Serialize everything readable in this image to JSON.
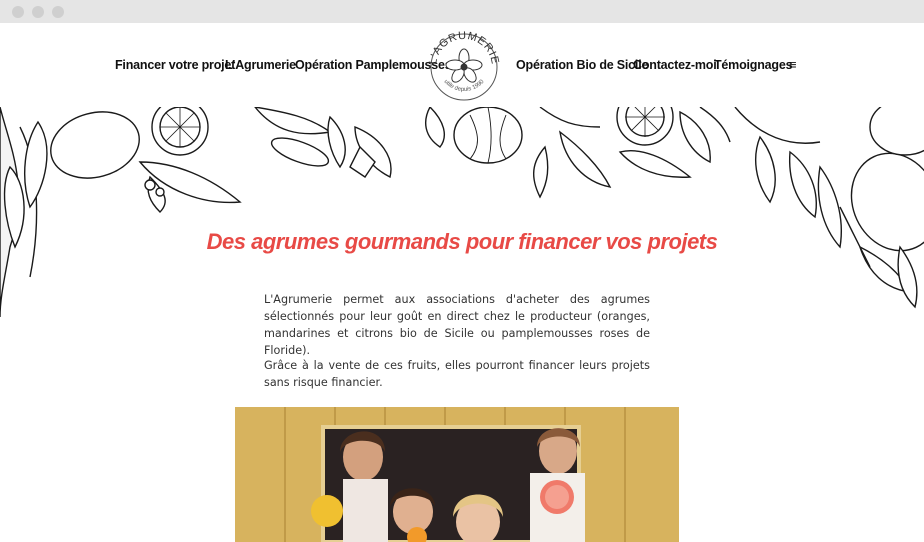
{
  "nav": {
    "items": [
      {
        "label": "Financer votre projet"
      },
      {
        "label": "L'Agrumerie"
      },
      {
        "label": "Opération Pamplemousses"
      },
      {
        "label": "Opération Bio de Sicile"
      },
      {
        "label": "Contactez-moi"
      },
      {
        "label": "Témoignages"
      }
    ],
    "menu_glyph": "≡"
  },
  "logo": {
    "name": "L'AGRUMERIE",
    "tagline": "utile depuis 1990"
  },
  "main": {
    "title": "Des agrumes gourmands pour financer vos projets",
    "paragraphs": [
      "L'Agrumerie permet aux associations d'acheter des agrumes sélectionnés pour leur goût en direct chez le producteur (oranges, mandarines et citrons bio de Sicile ou pamplemousses roses de Floride).",
      "Grâce à la vente de ces fruits, elles pourront financer leurs projets sans risque financier."
    ]
  },
  "colors": {
    "accent": "#e84a46",
    "chrome": "#e5e5e5",
    "text": "#333333"
  },
  "icons": {
    "menu": "hamburger-icon",
    "logo_flower": "orange-blossom-icon"
  }
}
